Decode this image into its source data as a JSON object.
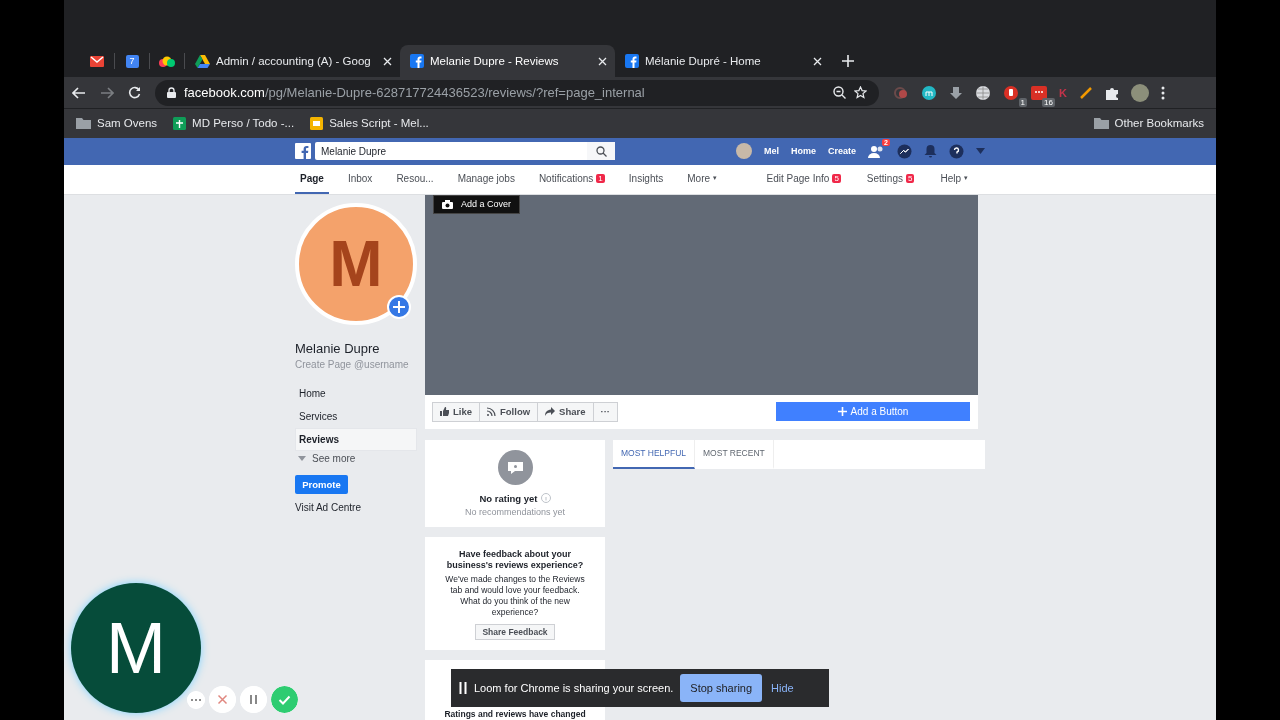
{
  "browser": {
    "tabs": [
      {
        "kind": "pinned",
        "selected": false
      },
      {
        "kind": "pinned",
        "label": "7",
        "selected": false
      },
      {
        "kind": "pinned",
        "selected": false
      },
      {
        "kind": "page",
        "title": "Admin / accounting (A) - Goog",
        "selected": false
      },
      {
        "kind": "page",
        "title": "Melanie Dupre - Reviews",
        "selected": true
      },
      {
        "kind": "page",
        "title": "Mélanie Dupré - Home",
        "selected": false
      }
    ],
    "address": {
      "host": "facebook.com",
      "path": "/pg/Melanie-Dupre-628717724436523/reviews/?ref=page_internal"
    },
    "extension_badges": [
      "1",
      "16"
    ],
    "extension_letter": "K",
    "bookmarks": [
      "Sam Ovens",
      "MD Perso / Todo -...",
      "Sales Script - Mel..."
    ],
    "other_bookmarks": "Other Bookmarks"
  },
  "header": {
    "search": "Melanie Dupre",
    "user": "Mel",
    "links": [
      "Home",
      "Create"
    ],
    "friend_requests": "2"
  },
  "page_nav": {
    "left": [
      {
        "label": "Page",
        "selected": true
      },
      {
        "label": "Inbox",
        "selected": false
      },
      {
        "label": "Resou...",
        "selected": false
      },
      {
        "label": "Manage jobs",
        "selected": false
      },
      {
        "label": "Notifications",
        "badge": "1",
        "selected": false
      },
      {
        "label": "Insights",
        "selected": false
      },
      {
        "label": "More",
        "caret": "▾",
        "selected": false
      }
    ],
    "right": [
      {
        "label": "Edit Page Info",
        "badge": "5"
      },
      {
        "label": "Settings",
        "badge": "5"
      },
      {
        "label": "Help",
        "caret": "▾"
      }
    ]
  },
  "profile": {
    "initial": "M",
    "name": "Melanie Dupre",
    "username": "Create Page @username",
    "nav": [
      {
        "label": "Home",
        "selected": false
      },
      {
        "label": "Services",
        "selected": false
      },
      {
        "label": "Reviews",
        "selected": true
      }
    ],
    "see_more": "See more",
    "promote": "Promote",
    "ad_centre": "Visit Ad Centre"
  },
  "cover": {
    "kind": "picture",
    "add_cover": "Add a Cover"
  },
  "actions": {
    "buttons": [
      "Like",
      "Follow",
      "Share"
    ],
    "more": "···",
    "add_button": "Add a Button"
  },
  "rating": {
    "title": "No rating yet",
    "subtitle": "No recommendations yet"
  },
  "feedback": {
    "title": "Have feedback about your business's reviews experience?",
    "body": "We've made changes to the Reviews tab and would love your feedback. What do you think of the new experience?",
    "button": "Share Feedback"
  },
  "notice": {
    "title": "Ratings and reviews have changed"
  },
  "sort_tabs": [
    {
      "label": "MOST HELPFUL",
      "selected": true
    },
    {
      "label": "MOST RECENT",
      "selected": false
    }
  ],
  "loom": {
    "initial": "M",
    "message": "Loom for Chrome is sharing your screen.",
    "stop": "Stop sharing",
    "hide": "Hide"
  }
}
